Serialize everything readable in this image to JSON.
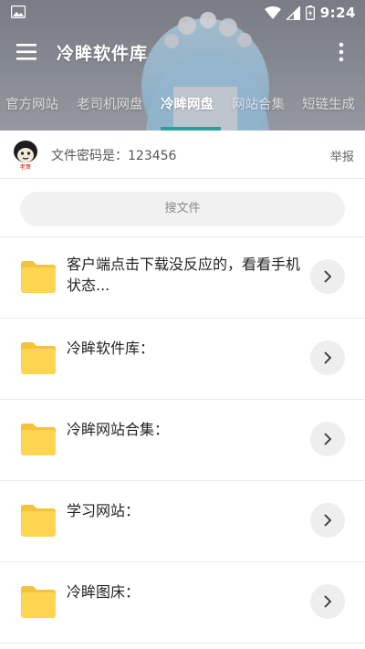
{
  "status_bar": {
    "time": "9:24",
    "icons": [
      "image-icon",
      "wifi-icon",
      "signal-icon",
      "battery-charging-icon"
    ]
  },
  "app_bar": {
    "title": "冷眸软件库",
    "menu_icon": "menu-icon",
    "more_icon": "more-vert-icon"
  },
  "tabs": [
    {
      "label": "官方网站",
      "active": false
    },
    {
      "label": "老司机网盘",
      "active": false
    },
    {
      "label": "冷眸网盘",
      "active": true
    },
    {
      "label": "网站合集",
      "active": false
    },
    {
      "label": "短链生成",
      "active": false
    }
  ],
  "info": {
    "password_text": "文件密码是：123456",
    "report_label": "举报",
    "avatar_caption": "老哥"
  },
  "search": {
    "label": "搜文件"
  },
  "files": [
    {
      "title": "客户端点击下载没反应的，看看手机状态...",
      "icon": "folder-icon"
    },
    {
      "title": "冷眸软件库：",
      "icon": "folder-icon"
    },
    {
      "title": "冷眸网站合集：",
      "icon": "folder-icon"
    },
    {
      "title": "学习网站：",
      "icon": "folder-icon"
    },
    {
      "title": "冷眸图床：",
      "icon": "folder-icon"
    }
  ],
  "colors": {
    "accent": "#2f9e9a",
    "folder": "#ffd14f",
    "header_overlay": "#8a8d95"
  }
}
